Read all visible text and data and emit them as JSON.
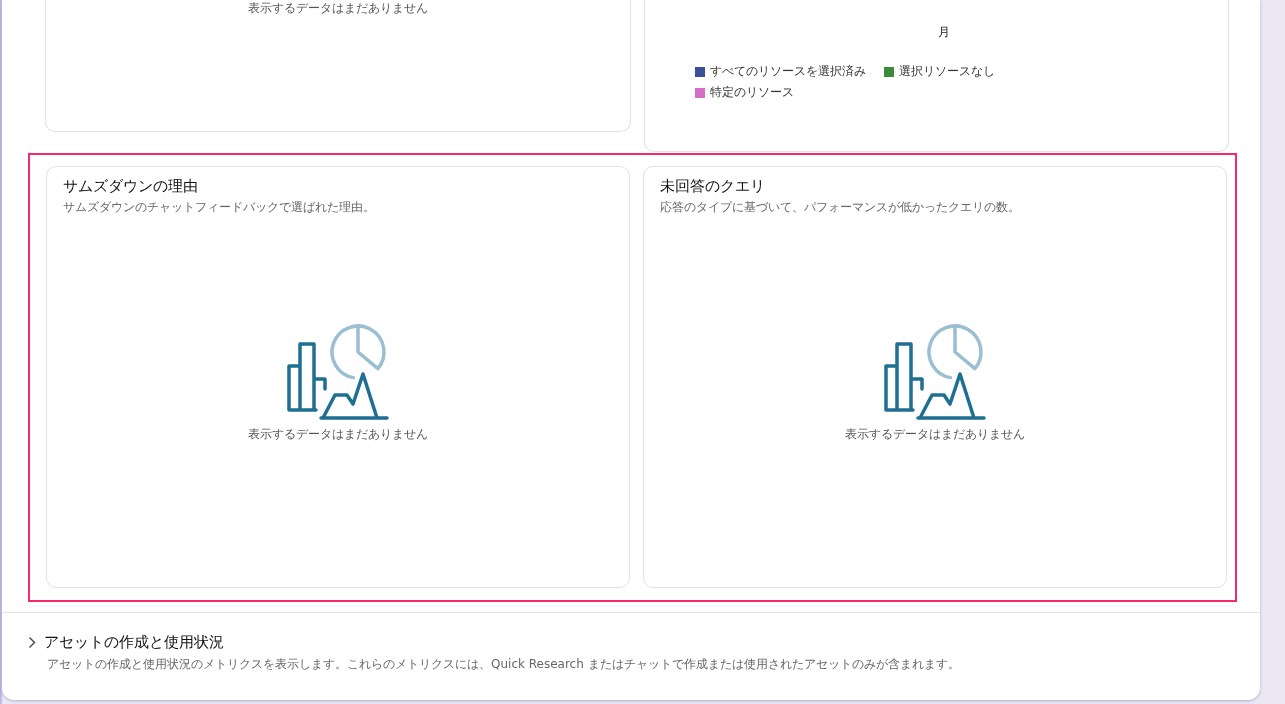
{
  "top_cards": [
    {
      "kind": "empty",
      "empty_text": "表示するデータはまだありません"
    },
    {
      "kind": "legend",
      "axis_label": "月",
      "legend": [
        {
          "label": "すべてのリソースを選択済み",
          "color": "#3d4f9a"
        },
        {
          "label": "選択リソースなし",
          "color": "#3f8a3a"
        },
        {
          "label": "特定のリソース",
          "color": "#d36ec4"
        }
      ]
    }
  ],
  "highlighted": true,
  "cards": [
    {
      "title": "サムズダウンの理由",
      "description": "サムズダウンのチャットフィードバックで選ばれた理由。",
      "empty_text": "表示するデータはまだありません"
    },
    {
      "title": "未回答のクエリ",
      "description": "応答のタイプに基づいて、パフォーマンスが低かったクエリの数。",
      "empty_text": "表示するデータはまだありません"
    }
  ],
  "section": {
    "expanded": false,
    "title": "アセットの作成と使用状況",
    "description": "アセットの作成と使用状況のメトリクスを表示します。これらのメトリクスには、Quick Research またはチャットで作成または使用されたアセットのみが含まれます。"
  }
}
